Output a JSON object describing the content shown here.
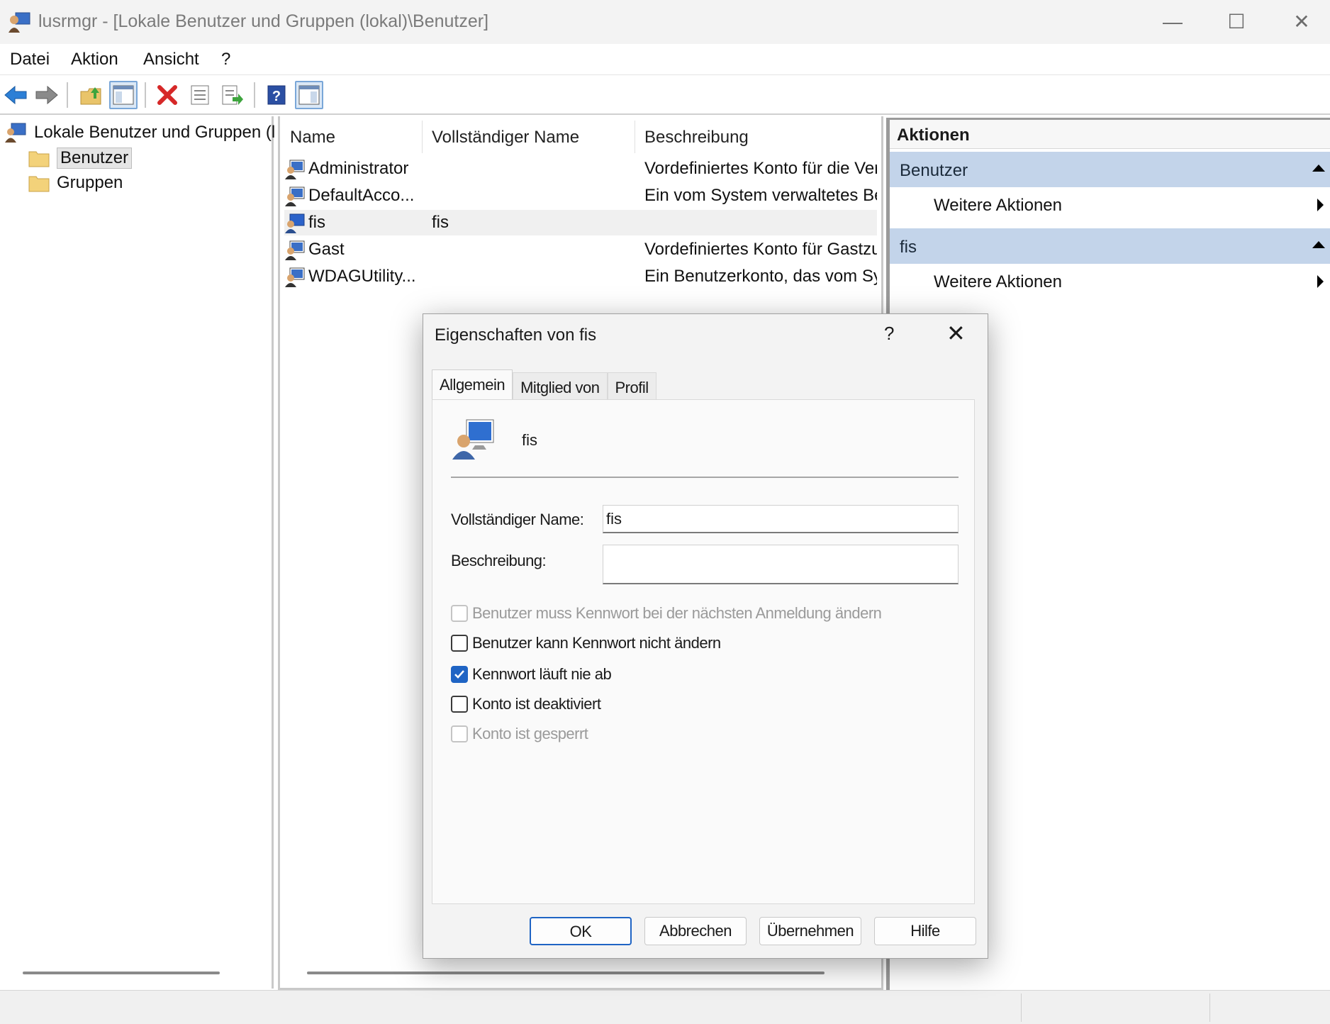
{
  "window": {
    "title": "lusrmgr - [Lokale Benutzer und Gruppen (lokal)\\Benutzer]",
    "minimize": "—",
    "maximize": "☐",
    "close": "✕"
  },
  "menu": [
    "Datei",
    "Aktion",
    "Ansicht",
    "?"
  ],
  "toolbar_icons": [
    "back-arrow-icon",
    "forward-arrow-icon",
    "up-folder-icon",
    "show-hide-tree-icon",
    "delete-icon",
    "properties-icon",
    "export-list-icon",
    "help-icon",
    "show-hide-action-pane-icon"
  ],
  "tree": {
    "root": "Lokale Benutzer und Gruppen (l",
    "children": [
      "Benutzer",
      "Gruppen"
    ],
    "selected": "Benutzer"
  },
  "list": {
    "columns": [
      "Name",
      "Vollständiger Name",
      "Beschreibung"
    ],
    "rows": [
      {
        "name": "Administrator",
        "full": "",
        "desc": "Vordefiniertes Konto für die Ver"
      },
      {
        "name": "DefaultAcco...",
        "full": "",
        "desc": "Ein vom System verwaltetes Ber"
      },
      {
        "name": "fis",
        "full": "fis",
        "desc": ""
      },
      {
        "name": "Gast",
        "full": "",
        "desc": "Vordefiniertes Konto für Gastzu"
      },
      {
        "name": "WDAGUtility...",
        "full": "",
        "desc": "Ein Benutzerkonto, das vom Sys"
      }
    ]
  },
  "actions": {
    "title": "Aktionen",
    "groups": [
      {
        "label": "Benutzer",
        "item": "Weitere Aktionen"
      },
      {
        "label": "fis",
        "item": "Weitere Aktionen"
      }
    ]
  },
  "dialog": {
    "title": "Eigenschaften von fis",
    "help": "?",
    "close": "✕",
    "tabs": [
      "Allgemein",
      "Mitglied von",
      "Profil"
    ],
    "active_tab": "Allgemein",
    "username": "fis",
    "full_name_label": "Vollständiger Name:",
    "full_name_value": "fis",
    "description_label": "Beschreibung:",
    "description_value": "",
    "checkboxes": [
      {
        "label": "Benutzer muss Kennwort bei der nächsten Anmeldung ändern",
        "checked": false,
        "disabled": true
      },
      {
        "label": "Benutzer kann Kennwort nicht ändern",
        "checked": false,
        "disabled": false
      },
      {
        "label": "Kennwort läuft nie ab",
        "checked": true,
        "disabled": false
      },
      {
        "label": "Konto ist deaktiviert",
        "checked": false,
        "disabled": false
      },
      {
        "label": "Konto ist gesperrt",
        "checked": false,
        "disabled": true
      }
    ],
    "buttons": {
      "ok": "OK",
      "cancel": "Abbrechen",
      "apply": "Übernehmen",
      "help": "Hilfe"
    }
  },
  "colors": {
    "accent": "#1f64c4",
    "actions_group_bg": "#c3d4ea",
    "selected_row": "#f0f0f0"
  }
}
